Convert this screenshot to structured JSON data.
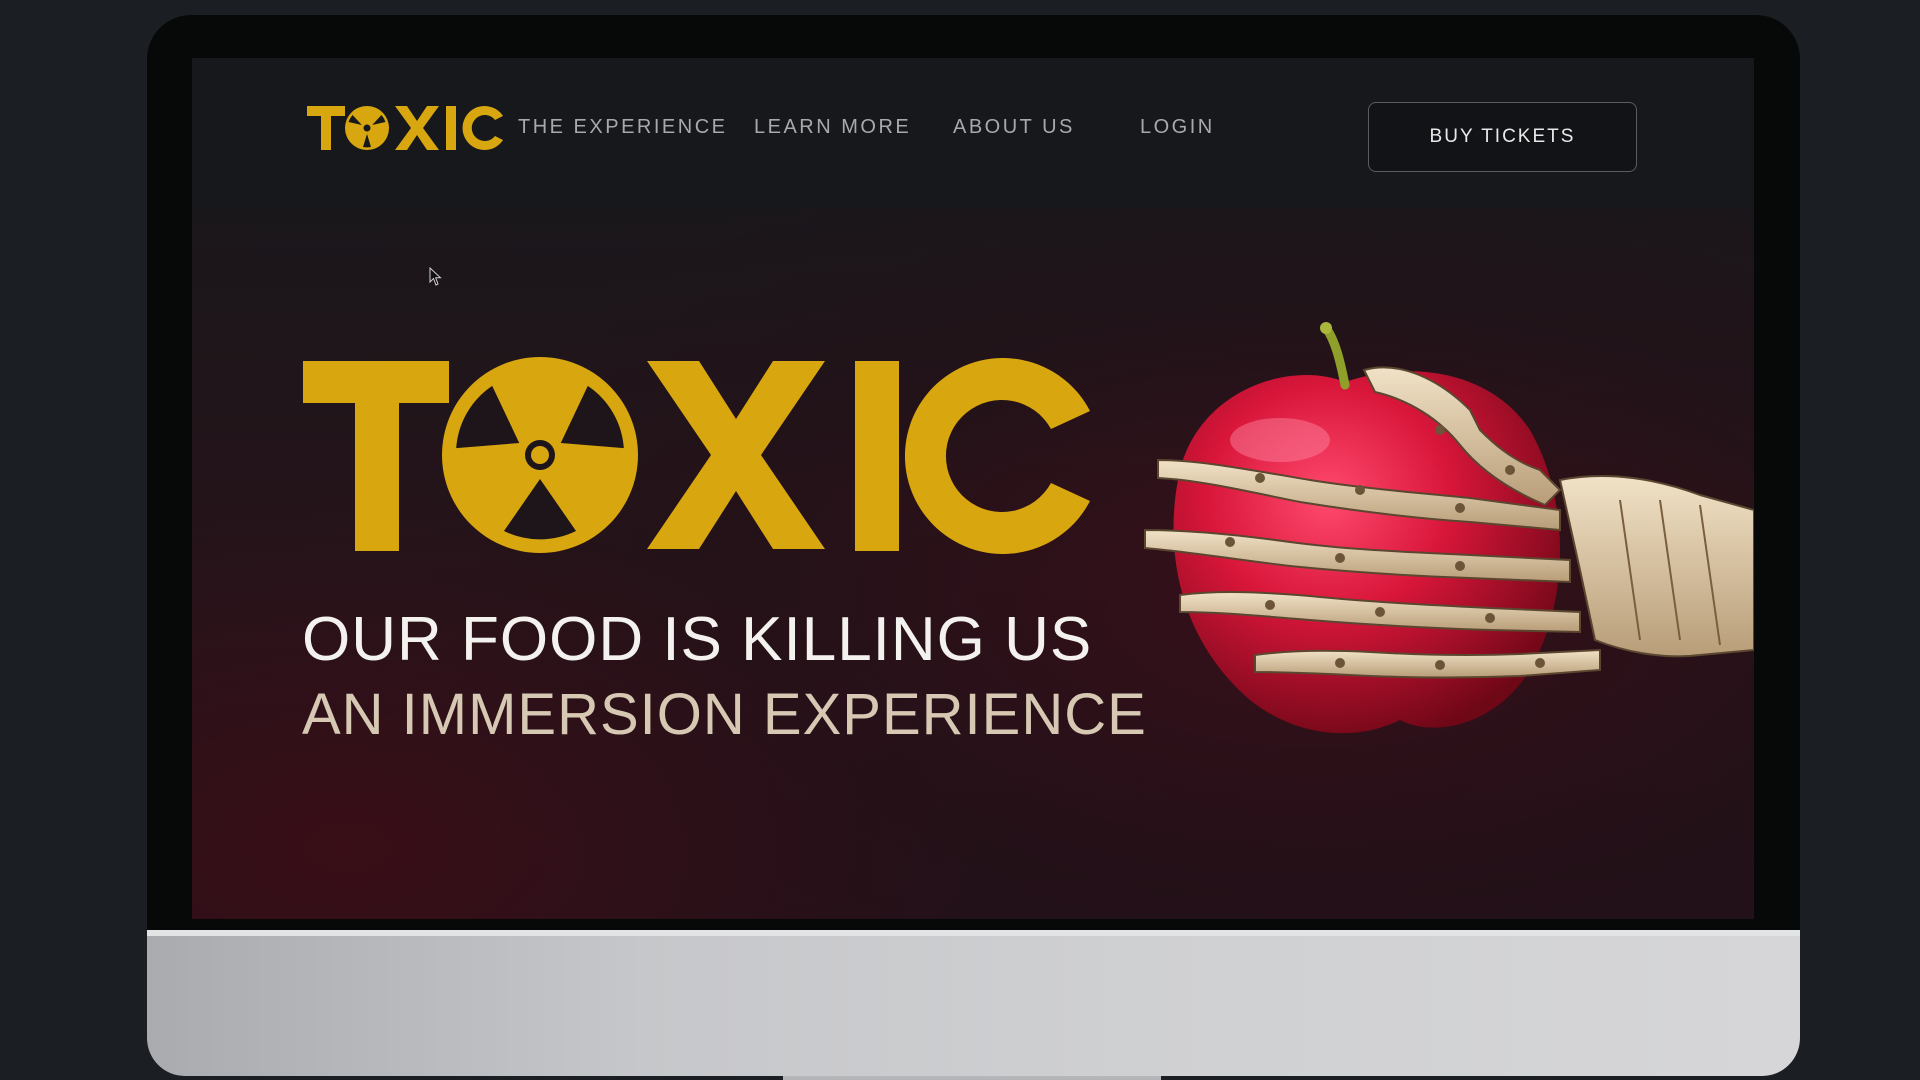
{
  "brand": {
    "name": "TOXIC",
    "accent_color": "#d8a60f"
  },
  "nav": {
    "links": [
      {
        "label": "THE EXPERIENCE"
      },
      {
        "label": "LEARN MORE"
      },
      {
        "label": "ABOUT US"
      },
      {
        "label": "LOGIN"
      }
    ],
    "cta_label": "BUY TICKETS"
  },
  "hero": {
    "tagline_primary": "OUR FOOD IS KILLING US",
    "tagline_secondary": "AN IMMERSION EXPERIENCE",
    "image_subject": "red apple gripped by skeleton hand"
  },
  "icons": {
    "radiation": "radiation-icon",
    "cursor": "mouse-pointer-icon"
  }
}
